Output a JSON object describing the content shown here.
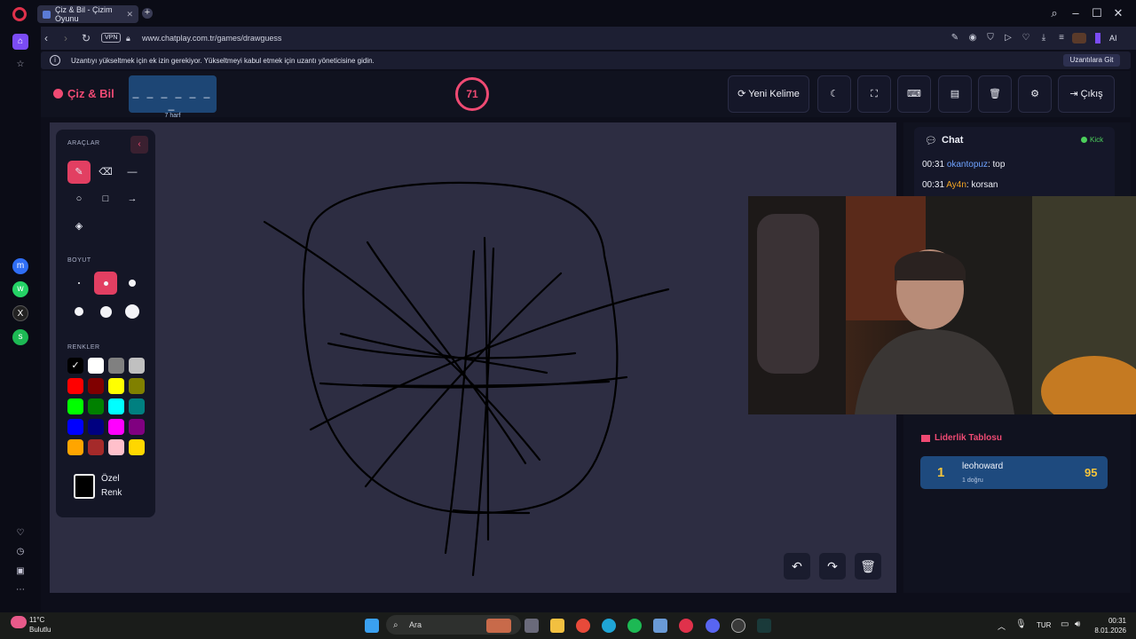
{
  "browser": {
    "tab_title": "Çiz & Bil - Çizim Oyunu",
    "url": "www.chatplay.com.tr/games/drawguess",
    "vpn_label": "VPN",
    "info_text": "Uzantıyı yükseltmek için ek izin gerekiyor. Yükseltmeyi kabul etmek için uzantı yöneticisine gidin.",
    "info_button": "Uzantılara Git",
    "ai_label": "AI"
  },
  "game": {
    "brand": "Çiz & Bil",
    "word_dashes": "_ _ _ _ _ _ _",
    "word_hint": "7 harf",
    "timer": "71",
    "buttons": {
      "new_word": "Yeni Kelime",
      "exit": "Çıkış"
    }
  },
  "tools": {
    "title": "ARAÇLAR",
    "size_title": "BOYUT",
    "colors_title": "RENKLER",
    "custom_color": "Özel Renk",
    "colors": [
      "#000000",
      "#ffffff",
      "#808080",
      "#c0c0c0",
      "#ff0000",
      "#800000",
      "#ffff00",
      "#808000",
      "#00ff00",
      "#008000",
      "#00ffff",
      "#008080",
      "#0000ff",
      "#000080",
      "#ff00ff",
      "#800080",
      "#ffa500",
      "#a52a2a",
      "#ffc0cb",
      "#ffd700"
    ]
  },
  "chat": {
    "title": "Chat",
    "platform": "Kick",
    "messages": [
      {
        "time": "00:31",
        "user": "okantopuz",
        "user_color": "#6fa3ff",
        "text": "top"
      },
      {
        "time": "00:31",
        "user": "Ay4n",
        "user_color": "#f5a623",
        "text": "korsan"
      }
    ]
  },
  "leaderboard": {
    "title": "Liderlik Tablosu",
    "entries": [
      {
        "rank": "1",
        "name": "leohoward",
        "sub": "1 doğru",
        "score": "95"
      }
    ]
  },
  "taskbar": {
    "weather_temp": "11°C",
    "weather_desc": "Bulutlu",
    "search": "Ara",
    "lang": "TUR",
    "time": "00:31",
    "date": "8.01.2026"
  }
}
